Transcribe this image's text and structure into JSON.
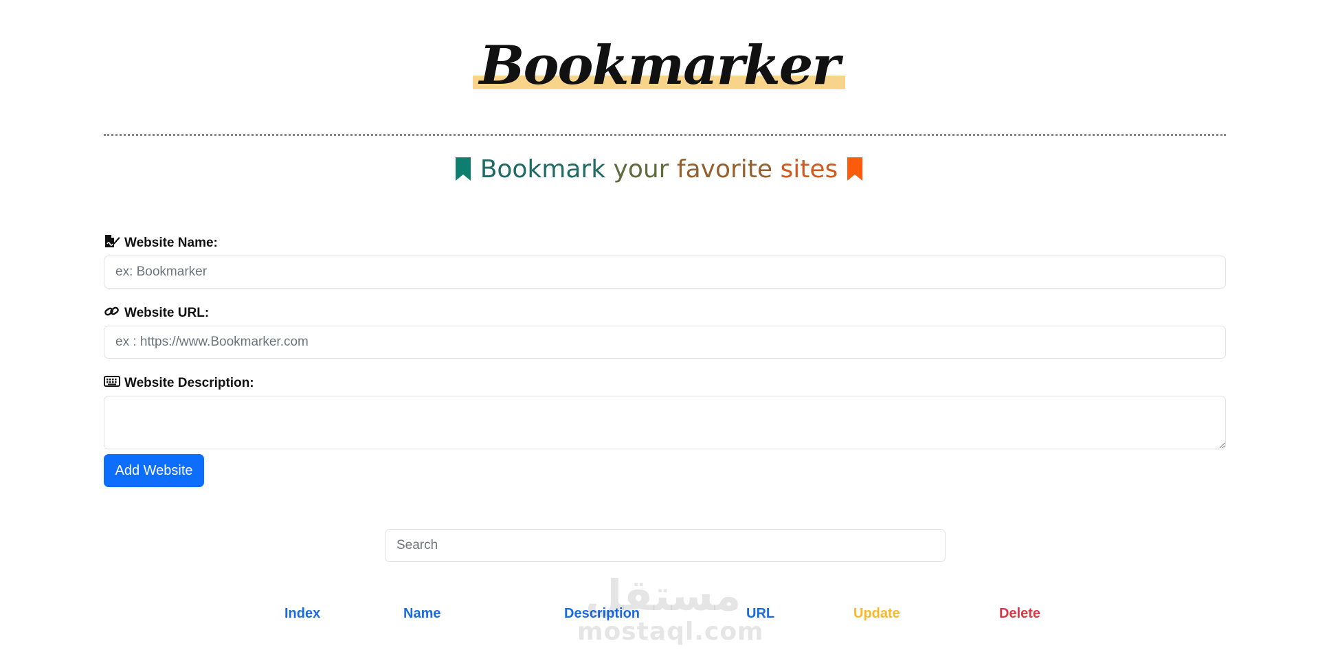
{
  "header": {
    "logo_text": "Bookmarker",
    "tagline_words": [
      "Bookmark",
      "your",
      "favorite",
      "sites"
    ],
    "tagline_colors": [
      "#1f6b63",
      "#5e6b3d",
      "#94602f",
      "#cf5a20"
    ],
    "tagline_icon_left_color": "#0e7f6e",
    "tagline_icon_right_color": "#fc5b0b"
  },
  "form": {
    "name_label": "Website Name:",
    "name_placeholder": "ex: Bookmarker",
    "url_label": "Website URL:",
    "url_placeholder": "ex : https://www.Bookmarker.com",
    "description_label": "Website Description:",
    "add_button_label": "Add Website"
  },
  "search": {
    "placeholder": "Search"
  },
  "table": {
    "headers": [
      "Index",
      "Name",
      "Description",
      "URL",
      "Update",
      "Delete"
    ]
  },
  "watermark": {
    "arabic": "مستقل",
    "latin": "mostaql.com"
  },
  "colors": {
    "primary": "#0d6efd",
    "update": "#f7b928",
    "delete": "#dc3545",
    "header_blue": "#1a6be0"
  }
}
